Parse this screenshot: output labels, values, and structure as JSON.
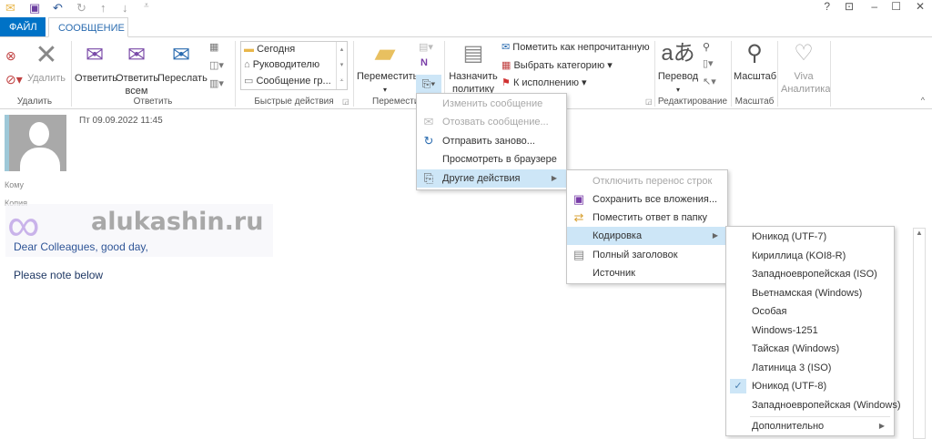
{
  "window": {
    "help": "?",
    "restore_icon": "ribbon-display-icon",
    "minimize": "–",
    "maximize": "☐",
    "close": "✕"
  },
  "tabs": [
    {
      "label": "ФАЙЛ"
    },
    {
      "label": "СООБЩЕНИЕ"
    }
  ],
  "ribbon": {
    "delete_group": {
      "label": "Удалить",
      "delete": "Удалить"
    },
    "reply_group": {
      "label": "Ответить",
      "reply": "Ответить",
      "reply_all": "Ответить всем",
      "forward": "Переслать"
    },
    "quick_steps": {
      "label": "Быстрые действия",
      "items": [
        "Сегодня",
        "Руководителю",
        "Сообщение гр..."
      ]
    },
    "move_group": {
      "label": "Переместить",
      "move": "Переместить"
    },
    "tags": {
      "assign_policy": "Назначить политику",
      "mark_unread": "Пометить как непрочитанную",
      "categorize": "Выбрать категорию",
      "followup": "К исполнению"
    },
    "editing": {
      "label": "Редактирование",
      "translate": "Перевод"
    },
    "zoom": {
      "label": "Масштаб",
      "zoom": "Масштаб"
    },
    "viva": {
      "label": "Viva Аналитика"
    }
  },
  "message": {
    "date": "Пт 09.09.2022 11:45",
    "to": "Кому",
    "cc": "Копия",
    "watermark": "alukashin.ru",
    "greeting": "Dear Colleagues, good day,",
    "body": "Please note below"
  },
  "menu1": [
    {
      "label": "Изменить сообщение"
    },
    {
      "label": "Отозвать сообщение..."
    },
    {
      "label": "Отправить заново..."
    },
    {
      "label": "Просмотреть в браузере"
    },
    {
      "label": "Другие действия"
    }
  ],
  "menu2": [
    {
      "label": "Отключить перенос строк"
    },
    {
      "label": "Сохранить все вложения..."
    },
    {
      "label": "Поместить ответ в папку"
    },
    {
      "label": "Кодировка"
    },
    {
      "label": "Полный заголовок"
    },
    {
      "label": "Источник"
    }
  ],
  "menu3": [
    {
      "label": "Юникод (UTF-7)"
    },
    {
      "label": "Кириллица (KOI8-R)"
    },
    {
      "label": "Западноевропейская (ISO)"
    },
    {
      "label": "Вьетнамская (Windows)"
    },
    {
      "label": "Особая"
    },
    {
      "label": "Windows-1251"
    },
    {
      "label": "Тайская (Windows)"
    },
    {
      "label": "Латиница 3 (ISO)"
    },
    {
      "label": "Юникод (UTF-8)",
      "checked": true
    },
    {
      "label": "Западноевропейская (Windows)"
    },
    {
      "label": "Дополнительно"
    }
  ],
  "colors": {
    "accent": "#0072c6",
    "highlight": "#cde6f7"
  }
}
